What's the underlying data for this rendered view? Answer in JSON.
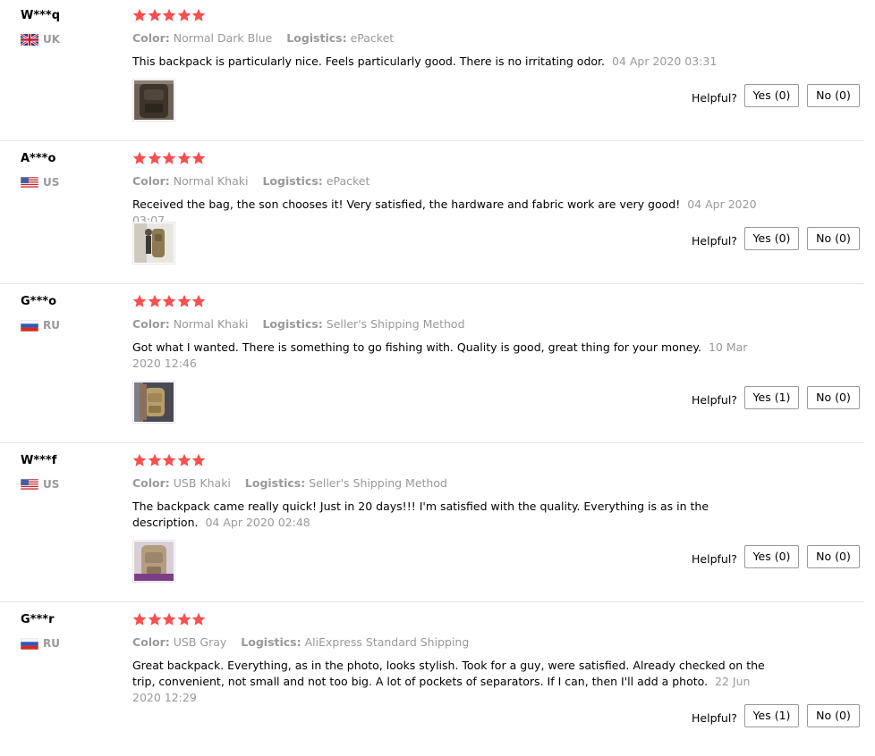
{
  "labels": {
    "color": "Color:",
    "logistics": "Logistics:",
    "helpful": "Helpful?"
  },
  "accent": {
    "star": "#f74f4f",
    "muted": "#999999"
  },
  "reviews": [
    {
      "user": "W***q",
      "country": "UK",
      "flag": "uk-flag-icon",
      "rating": 5,
      "color": "Normal Dark Blue",
      "logistics": "ePacket",
      "text": "This backpack is particularly nice. Feels particularly good. There is no irritating odor.",
      "time": "04 Apr 2020 03:31",
      "yes": "Yes (0)",
      "no": "No (0)"
    },
    {
      "user": "A***o",
      "country": "US",
      "flag": "us-flag-icon",
      "rating": 5,
      "color": "Normal Khaki",
      "logistics": "ePacket",
      "text": "Received the bag, the son chooses it! Very satisfied, the hardware and fabric work are very good!",
      "time": "04 Apr 2020 03:07",
      "yes": "Yes (0)",
      "no": "No (0)"
    },
    {
      "user": "G***o",
      "country": "RU",
      "flag": "ru-flag-icon",
      "rating": 5,
      "color": "Normal Khaki",
      "logistics": "Seller's Shipping Method",
      "text": "Got what I wanted. There is something to go fishing with. Quality is good, great thing for your money.",
      "time": "10 Mar 2020 12:46",
      "yes": "Yes (1)",
      "no": "No (0)"
    },
    {
      "user": "W***f",
      "country": "US",
      "flag": "us-flag-icon",
      "rating": 5,
      "color": "USB Khaki",
      "logistics": "Seller's Shipping Method",
      "text": "The backpack came really quick! Just in 20 days!!! I'm satisfied with the quality. Everything is as in the description.",
      "time": "04 Apr 2020 02:48",
      "yes": "Yes (0)",
      "no": "No (0)"
    },
    {
      "user": "G***r",
      "country": "RU",
      "flag": "ru-flag-icon",
      "rating": 5,
      "color": "USB Gray",
      "logistics": "AliExpress Standard Shipping",
      "text": "Great backpack. Everything, as in the photo, looks stylish. Took for a guy, were satisfied. Already checked on the trip, convenient, not small and not too big. A lot of pockets of separators. If I can, then I'll add a photo.",
      "time": "22 Jun 2020 12:29",
      "yes": "Yes (1)",
      "no": "No (0)"
    }
  ]
}
